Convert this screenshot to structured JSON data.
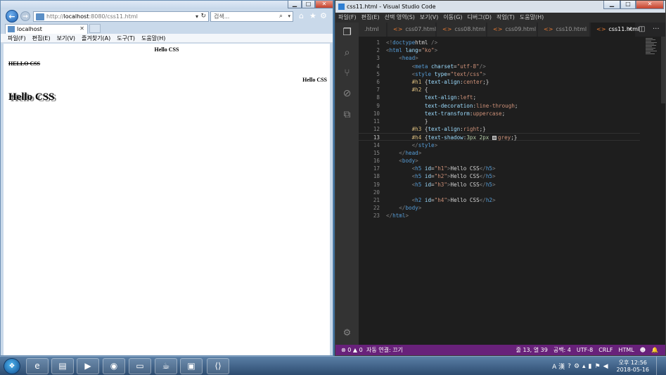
{
  "browser": {
    "url_prefix": "http://",
    "url_host": "localhost",
    "url_rest": ":8080/css11.html",
    "search_placeholder": "검색...",
    "tab_label": "localhost",
    "menus": [
      "파일(F)",
      "편집(E)",
      "보기(V)",
      "즐겨찾기(A)",
      "도구(T)",
      "도움말(H)"
    ],
    "content": {
      "h1": "Hello CSS",
      "h2": "Hello CSS",
      "h3": "Hello CSS",
      "h4": "Hello CSS"
    }
  },
  "editor": {
    "title": "css11.html - Visual Studio Code",
    "menus": [
      "파일(F)",
      "편집(E)",
      "선택 영역(S)",
      "보기(V)",
      "이동(G)",
      "디버그(D)",
      "작업(T)",
      "도움말(H)"
    ],
    "tabs": [
      {
        "label": ".html",
        "active": false
      },
      {
        "label": "css07.html",
        "active": false
      },
      {
        "label": "css08.html",
        "active": false
      },
      {
        "label": "css09.html",
        "active": false
      },
      {
        "label": "css10.html",
        "active": false
      },
      {
        "label": "css11.html",
        "active": true
      }
    ],
    "tab_icon": "<>",
    "current_line": 13,
    "lines": [
      [
        [
          "tk-punc",
          "<!"
        ],
        [
          "tk-tag",
          "doctype"
        ],
        [
          "",
          "html"
        ],
        [
          "tk-punc",
          " />"
        ]
      ],
      [
        [
          "tk-punc",
          "<"
        ],
        [
          "tk-tag",
          "html"
        ],
        [
          "",
          " "
        ],
        [
          "tk-attr",
          "lang"
        ],
        [
          "",
          "="
        ],
        [
          "tk-str",
          "\"ko\""
        ],
        [
          "tk-punc",
          ">"
        ]
      ],
      [
        [
          "",
          "    "
        ],
        [
          "tk-punc",
          "<"
        ],
        [
          "tk-tag",
          "head"
        ],
        [
          "tk-punc",
          ">"
        ]
      ],
      [
        [
          "",
          "        "
        ],
        [
          "tk-punc",
          "<"
        ],
        [
          "tk-tag",
          "meta"
        ],
        [
          "",
          " "
        ],
        [
          "tk-attr",
          "charset"
        ],
        [
          "",
          "="
        ],
        [
          "tk-str",
          "\"utf-8\""
        ],
        [
          "tk-punc",
          "/>"
        ]
      ],
      [
        [
          "",
          "        "
        ],
        [
          "tk-punc",
          "<"
        ],
        [
          "tk-tag",
          "style"
        ],
        [
          "",
          " "
        ],
        [
          "tk-attr",
          "type"
        ],
        [
          "",
          "="
        ],
        [
          "tk-str",
          "\"text/css\""
        ],
        [
          "tk-punc",
          ">"
        ]
      ],
      [
        [
          "",
          "        "
        ],
        [
          "tk-sel",
          "#h1"
        ],
        [
          "",
          " {"
        ],
        [
          "tk-prop",
          "text-align"
        ],
        [
          "",
          ":"
        ],
        [
          "tk-val",
          "center"
        ],
        [
          "",
          ";}"
        ]
      ],
      [
        [
          "",
          "        "
        ],
        [
          "tk-sel",
          "#h2"
        ],
        [
          "",
          " {"
        ]
      ],
      [
        [
          "",
          "            "
        ],
        [
          "tk-prop",
          "text-align"
        ],
        [
          "",
          ":"
        ],
        [
          "tk-val",
          "left"
        ],
        [
          "",
          ";"
        ]
      ],
      [
        [
          "",
          "            "
        ],
        [
          "tk-prop",
          "text-decoration"
        ],
        [
          "",
          ":"
        ],
        [
          "tk-val",
          "line-through"
        ],
        [
          "",
          ";"
        ]
      ],
      [
        [
          "",
          "            "
        ],
        [
          "tk-prop",
          "text-transform"
        ],
        [
          "",
          ":"
        ],
        [
          "tk-val",
          "uppercase"
        ],
        [
          "",
          ";"
        ]
      ],
      [
        [
          "",
          "            }"
        ]
      ],
      [
        [
          "",
          "        "
        ],
        [
          "tk-sel",
          "#h3"
        ],
        [
          "",
          " {"
        ],
        [
          "tk-prop",
          "text-align"
        ],
        [
          "",
          ":"
        ],
        [
          "tk-val",
          "right"
        ],
        [
          "",
          ";}"
        ]
      ],
      [
        [
          "",
          "        "
        ],
        [
          "tk-sel",
          "#h4"
        ],
        [
          "",
          " {"
        ],
        [
          "tk-prop",
          "text-shadow"
        ],
        [
          "",
          ":"
        ],
        [
          "tk-num",
          "3px"
        ],
        [
          "",
          " "
        ],
        [
          "tk-num",
          "2px"
        ],
        [
          "",
          " "
        ],
        [
          "swatch",
          ""
        ],
        [
          "tk-val",
          "grey"
        ],
        [
          "",
          ";}"
        ]
      ],
      [
        [
          "",
          "        "
        ],
        [
          "tk-punc",
          "</"
        ],
        [
          "tk-tag",
          "style"
        ],
        [
          "tk-punc",
          ">"
        ]
      ],
      [
        [
          "",
          "    "
        ],
        [
          "tk-punc",
          "</"
        ],
        [
          "tk-tag",
          "head"
        ],
        [
          "tk-punc",
          ">"
        ]
      ],
      [
        [
          "",
          "    "
        ],
        [
          "tk-punc",
          "<"
        ],
        [
          "tk-tag",
          "body"
        ],
        [
          "tk-punc",
          ">"
        ]
      ],
      [
        [
          "",
          "        "
        ],
        [
          "tk-punc",
          "<"
        ],
        [
          "tk-tag",
          "h5"
        ],
        [
          "",
          " "
        ],
        [
          "tk-attr",
          "id"
        ],
        [
          "",
          "="
        ],
        [
          "tk-str",
          "\"h1\""
        ],
        [
          "tk-punc",
          ">"
        ],
        [
          "",
          "Hello CSS"
        ],
        [
          "tk-punc",
          "</"
        ],
        [
          "tk-tag",
          "h5"
        ],
        [
          "tk-punc",
          ">"
        ]
      ],
      [
        [
          "",
          "        "
        ],
        [
          "tk-punc",
          "<"
        ],
        [
          "tk-tag",
          "h5"
        ],
        [
          "",
          " "
        ],
        [
          "tk-attr",
          "id"
        ],
        [
          "",
          "="
        ],
        [
          "tk-str",
          "\"h2\""
        ],
        [
          "tk-punc",
          ">"
        ],
        [
          "",
          "Hello CSS"
        ],
        [
          "tk-punc",
          "</"
        ],
        [
          "tk-tag",
          "h5"
        ],
        [
          "tk-punc",
          ">"
        ]
      ],
      [
        [
          "",
          "        "
        ],
        [
          "tk-punc",
          "<"
        ],
        [
          "tk-tag",
          "h5"
        ],
        [
          "",
          " "
        ],
        [
          "tk-attr",
          "id"
        ],
        [
          "",
          "="
        ],
        [
          "tk-str",
          "\"h3\""
        ],
        [
          "tk-punc",
          ">"
        ],
        [
          "",
          "Hello CSS"
        ],
        [
          "tk-punc",
          "</"
        ],
        [
          "tk-tag",
          "h5"
        ],
        [
          "tk-punc",
          ">"
        ]
      ],
      [
        [
          "",
          ""
        ]
      ],
      [
        [
          "",
          "        "
        ],
        [
          "tk-punc",
          "<"
        ],
        [
          "tk-tag",
          "h2"
        ],
        [
          "",
          " "
        ],
        [
          "tk-attr",
          "id"
        ],
        [
          "",
          "="
        ],
        [
          "tk-str",
          "\"h4\""
        ],
        [
          "tk-punc",
          ">"
        ],
        [
          "",
          "Hello CSS"
        ],
        [
          "tk-punc",
          "</"
        ],
        [
          "tk-tag",
          "h2"
        ],
        [
          "tk-punc",
          ">"
        ]
      ],
      [
        [
          "",
          "    "
        ],
        [
          "tk-punc",
          "</"
        ],
        [
          "tk-tag",
          "body"
        ],
        [
          "tk-punc",
          ">"
        ]
      ],
      [
        [
          "tk-punc",
          "</"
        ],
        [
          "tk-tag",
          "html"
        ],
        [
          "tk-punc",
          ">"
        ]
      ]
    ],
    "status": {
      "problems": "⊗ 0 ▲ 0",
      "live": "자동 연결: 끄기",
      "position": "줄 13, 열 39",
      "spaces": "공백: 4",
      "encoding": "UTF-8",
      "eol": "CRLF",
      "language": "HTML",
      "feedback": "☻",
      "bell": "🔔"
    }
  },
  "taskbar": {
    "clock_time": "오후 12:56",
    "clock_date": "2018-05-16",
    "ime": "A 漢"
  },
  "colors": {
    "statusbar": "#68217a",
    "editor_bg": "#1e1e1e"
  }
}
